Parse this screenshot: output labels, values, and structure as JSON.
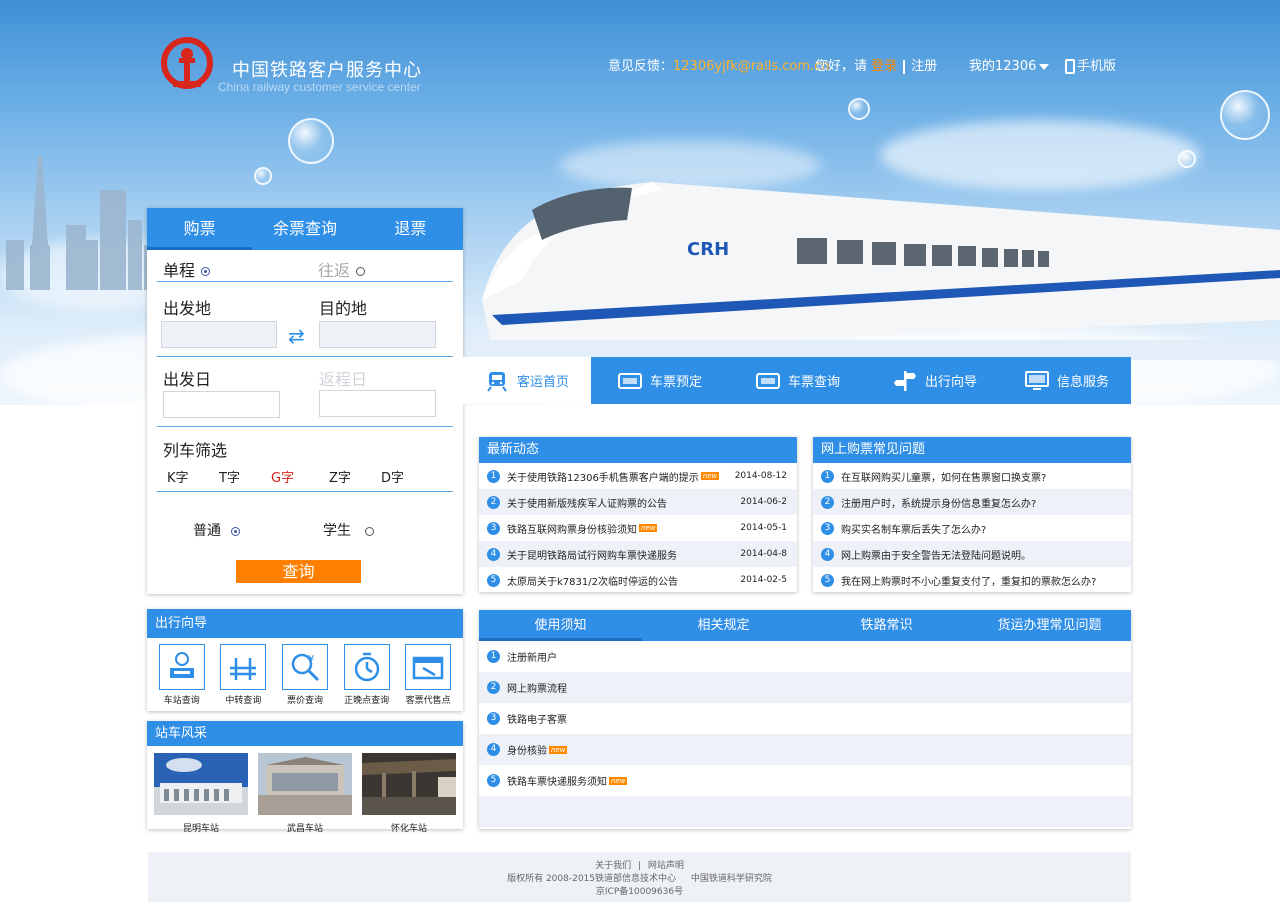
{
  "header": {
    "site_title": "中国铁路客户服务中心",
    "site_subtitle": "China railway customer service center",
    "feedback_label": "意见反馈：",
    "feedback_email": "12306yjfk@rails.com.cn",
    "greeting": "您好，请",
    "login": "登录",
    "register": "注册",
    "my12306": "我的12306",
    "mobile": "手机版"
  },
  "booking": {
    "tabs": [
      "购票",
      "余票查询",
      "退票"
    ],
    "one_way": "单程",
    "round_trip": "往返",
    "from_label": "出发地",
    "to_label": "目的地",
    "depart_date_label": "出发日",
    "return_date_label": "返程日",
    "filter_label": "列车筛选",
    "train_types": [
      "K字",
      "T字",
      "G字",
      "Z字",
      "D字"
    ],
    "ordinary": "普通",
    "student": "学生",
    "search_button": "查询"
  },
  "mainnav": {
    "items": [
      "客运首页",
      "车票预定",
      "车票查询",
      "出行向导",
      "信息服务"
    ]
  },
  "news": {
    "title": "最新动态",
    "items": [
      {
        "text": "关于使用铁路12306手机售票客户端的提示",
        "date": "2014-08-12",
        "new": "new"
      },
      {
        "text": "关于使用新版残疾军人证购票的公告",
        "date": "2014-06-2",
        "new": ""
      },
      {
        "text": "铁路互联网购票身份核验须知",
        "date": "2014-05-1",
        "new": "new"
      },
      {
        "text": "关于昆明铁路局试行网购车票快递服务",
        "date": "2014-04-8",
        "new": ""
      },
      {
        "text": "太原局关于k7831/2次临时停运的公告",
        "date": "2014-02-5",
        "new": ""
      }
    ]
  },
  "faq": {
    "title": "网上购票常见问题",
    "items": [
      "在互联网购买儿童票，如何在售票窗口换支票?",
      "注册用户时，系统提示身份信息重复怎么办?",
      "购买实名制车票后丢失了怎么办?",
      "网上购票由于安全警告无法登陆问题说明。",
      "我在网上购票时不小心重复支付了，重复扣的票款怎么办?"
    ]
  },
  "guide": {
    "title": "出行向导",
    "items": [
      "车站查询",
      "中转查询",
      "票价查询",
      "正晚点查询",
      "客票代售点"
    ]
  },
  "stations": {
    "title": "站车风采",
    "items": [
      "昆明车站",
      "武昌车站",
      "怀化车站"
    ]
  },
  "info_tabs": {
    "tabs": [
      "使用须知",
      "相关规定",
      "铁路常识",
      "货运办理常见问题"
    ],
    "items": [
      {
        "text": "注册新用户",
        "new": ""
      },
      {
        "text": "网上购票流程",
        "new": ""
      },
      {
        "text": "铁路电子客票",
        "new": ""
      },
      {
        "text": "身份核验",
        "new": "new"
      },
      {
        "text": "铁路车票快递服务须知",
        "new": "new"
      }
    ]
  },
  "footer": {
    "about": "关于我们",
    "statement": "网站声明",
    "copyright": "版权所有 2008-2015铁道部信息技术中心",
    "institute": "中国铁道科学研究院",
    "icp": "京ICP备10009636号"
  },
  "colors": {
    "primary": "#2f8ee6",
    "accent": "#ff7f00",
    "email": "#ffb12a",
    "logo_red": "#d9261c"
  }
}
